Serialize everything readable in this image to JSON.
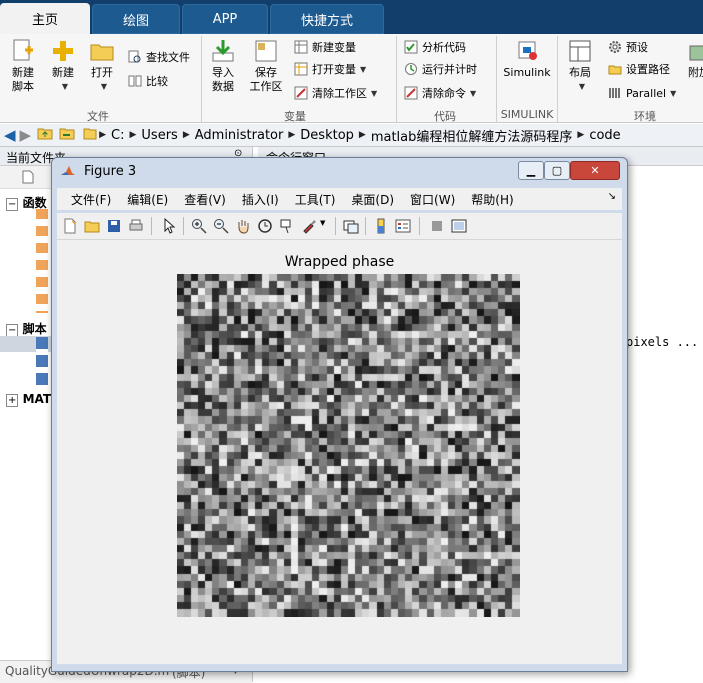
{
  "app": {
    "tabs": [
      {
        "label": "主页",
        "active": true
      },
      {
        "label": "绘图",
        "active": false
      },
      {
        "label": "APP",
        "active": false
      },
      {
        "label": "快捷方式",
        "active": false
      }
    ]
  },
  "ribbon": {
    "file_group": {
      "label": "文件",
      "new_script": "新建\n脚本",
      "new": "新建",
      "open": "打开",
      "find_files": "查找文件",
      "compare": "比较"
    },
    "variable_group": {
      "label": "变量",
      "import_data": "导入\n数据",
      "save_workspace": "保存\n工作区",
      "new_variable": "新建变量",
      "open_variable": "打开变量",
      "clear_workspace": "清除工作区"
    },
    "code_group": {
      "label": "代码",
      "analyze_code": "分析代码",
      "run_and_time": "运行并计时",
      "clear_commands": "清除命令"
    },
    "simulink_group": {
      "label": "SIMULINK",
      "simulink": "Simulink"
    },
    "environment_group": {
      "label": "环境",
      "layout": "布局",
      "preferences": "预设",
      "set_path": "设置路径",
      "parallel": "Parallel",
      "addons": "附加"
    }
  },
  "address_bar": {
    "crumbs": [
      "C:",
      "Users",
      "Administrator",
      "Desktop",
      "matlab编程相位解缠方法源码程序",
      "code"
    ]
  },
  "left_panel": {
    "title": "当前文件夹",
    "sections": [
      "函数",
      "脚本",
      "MAT"
    ],
    "bottom_file": "QualityGuidedUnwrap2D.m",
    "bottom_file_suffix": "(脚本)"
  },
  "right_panel": {
    "title": "命令行窗口",
    "text_fragment": "pixels ..."
  },
  "figure": {
    "title": "Figure 3",
    "menus": [
      "文件(F)",
      "编辑(E)",
      "查看(V)",
      "插入(I)",
      "工具(T)",
      "桌面(D)",
      "窗口(W)",
      "帮助(H)"
    ],
    "plot_title": "Wrapped phase",
    "minimize_icon": "minimize-icon",
    "maximize_icon": "maximize-icon",
    "close_icon": "close-icon"
  }
}
